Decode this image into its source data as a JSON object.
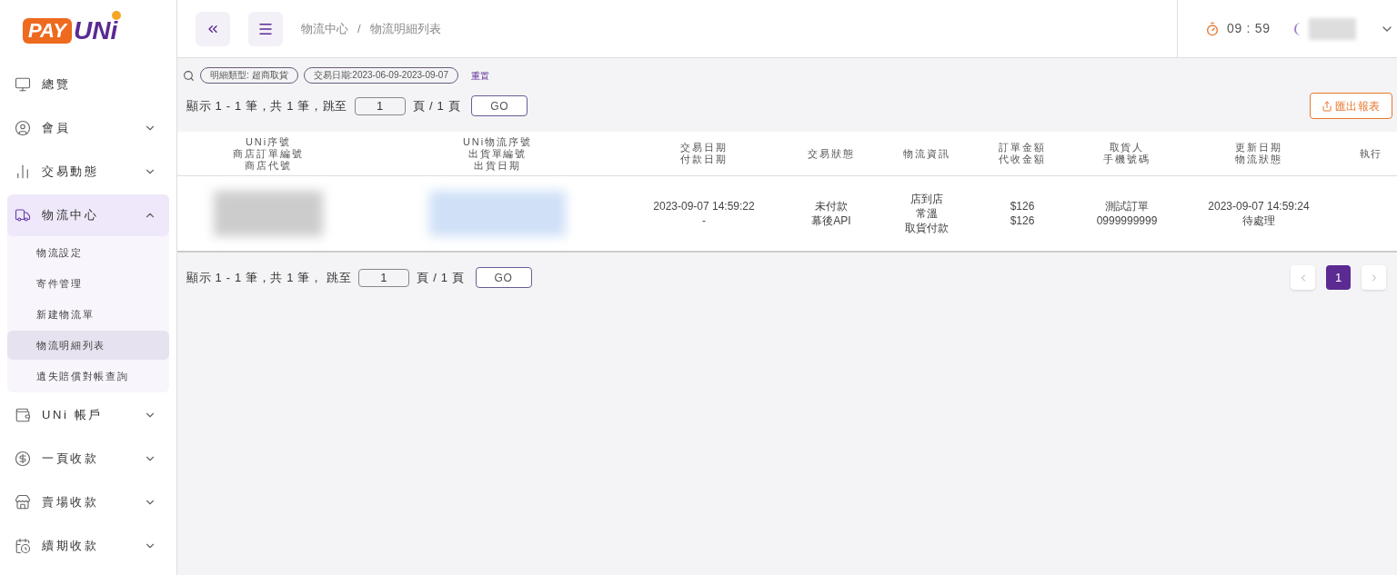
{
  "logo": {
    "part_1": "PAY",
    "part_2": "UNi"
  },
  "sidebar": {
    "items": [
      {
        "label": "總覽",
        "selected": false
      },
      {
        "label": "會員",
        "selected": false,
        "expanded": false
      },
      {
        "label": "交易動態",
        "selected": false,
        "expanded": false
      },
      {
        "label": "物流中心",
        "selected": true,
        "expanded": true,
        "children": [
          {
            "label": "物流設定",
            "selected": false
          },
          {
            "label": "寄件管理",
            "selected": false
          },
          {
            "label": "新建物流單",
            "selected": false
          },
          {
            "label": "物流明細列表",
            "selected": true
          },
          {
            "label": "遺失賠償對帳查詢",
            "selected": false
          }
        ]
      },
      {
        "label": "UNi 帳戶",
        "selected": false,
        "expanded": false
      },
      {
        "label": "一頁收款",
        "selected": false,
        "expanded": false
      },
      {
        "label": "賣場收款",
        "selected": false,
        "expanded": false
      },
      {
        "label": "續期收款",
        "selected": false,
        "expanded": false
      }
    ]
  },
  "breadcrumb": [
    "物流中心",
    "物流明細列表"
  ],
  "breadcrumb_separator": "/",
  "timer": "09 : 59",
  "filters": {
    "chips": [
      "明細類型: 超商取貨",
      "交易日期:2023-06-09-2023-09-07"
    ],
    "reset": "重置"
  },
  "pager_top": {
    "prefix": "顯示 1 - 1 筆，共 1 筆，跳至",
    "page": "1",
    "suffix": "頁 / 1 頁",
    "go": "GO"
  },
  "export_button": "匯出報表",
  "table": {
    "columns": [
      {
        "lines": [
          "UNi序號",
          "商店訂單編號",
          "商店代號"
        ]
      },
      {
        "lines": [
          "UNi物流序號",
          "出貨單編號",
          "出貨日期"
        ]
      },
      {
        "lines": [
          "交易日期",
          "付款日期"
        ]
      },
      {
        "lines": [
          "交易狀態"
        ]
      },
      {
        "lines": [
          "物流資訊"
        ]
      },
      {
        "lines": [
          "訂單金額",
          "代收金額"
        ]
      },
      {
        "lines": [
          "取貨人",
          "手機號碼"
        ]
      },
      {
        "lines": [
          "更新日期",
          "物流狀態"
        ]
      },
      {
        "lines": [
          "執行"
        ]
      }
    ],
    "rows": [
      {
        "cells": [
          {
            "kind": "redacted"
          },
          {
            "kind": "redacted"
          },
          {
            "kind": "text",
            "lines": [
              "2023-09-07 14:59:22",
              "-"
            ]
          },
          {
            "kind": "text",
            "lines": [
              "未付款",
              "幕後API"
            ]
          },
          {
            "kind": "text",
            "lines": [
              "店到店",
              "常溫",
              "取貨付款"
            ]
          },
          {
            "kind": "text",
            "lines": [
              "$126",
              "$126"
            ]
          },
          {
            "kind": "text",
            "lines": [
              "測試訂單",
              "0999999999"
            ]
          },
          {
            "kind": "text",
            "lines": [
              "2023-09-07 14:59:24",
              "待處理"
            ]
          },
          {
            "kind": "empty"
          }
        ]
      }
    ]
  },
  "pager_bottom": {
    "prefix": "顯示 1 - 1 筆，共 1 筆， 跳至",
    "page": "1",
    "suffix": "頁 / 1 頁",
    "go": "GO"
  },
  "pagination": {
    "pages": [
      {
        "label": "1",
        "selected": true
      }
    ]
  }
}
